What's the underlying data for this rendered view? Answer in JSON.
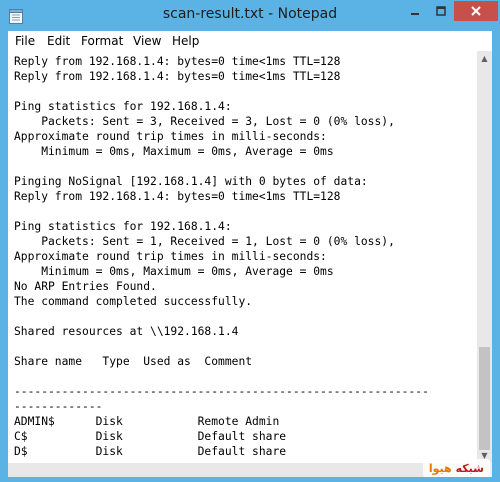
{
  "window": {
    "title": "scan-result.txt - Notepad",
    "accent": "#5ab3e4",
    "close_color": "#c7504b"
  },
  "menu": [
    "File",
    "Edit",
    "Format",
    "View",
    "Help"
  ],
  "text_lines": [
    "Reply from 192.168.1.4: bytes=0 time<1ms TTL=128",
    "Reply from 192.168.1.4: bytes=0 time<1ms TTL=128",
    "",
    "Ping statistics for 192.168.1.4:",
    "    Packets: Sent = 3, Received = 3, Lost = 0 (0% loss),",
    "Approximate round trip times in milli-seconds:",
    "    Minimum = 0ms, Maximum = 0ms, Average = 0ms",
    "",
    "Pinging NoSignal [192.168.1.4] with 0 bytes of data:",
    "Reply from 192.168.1.4: bytes=0 time<1ms TTL=128",
    "",
    "Ping statistics for 192.168.1.4:",
    "    Packets: Sent = 1, Received = 1, Lost = 0 (0% loss),",
    "Approximate round trip times in milli-seconds:",
    "    Minimum = 0ms, Maximum = 0ms, Average = 0ms",
    "No ARP Entries Found.",
    "The command completed successfully.",
    "",
    "Shared resources at \\\\192.168.1.4",
    "",
    "Share name   Type  Used as  Comment",
    "",
    "-------------------------------------------------------------",
    "-------------",
    "ADMIN$      Disk           Remote Admin",
    "C$          Disk           Default share",
    "D$          Disk           Default share"
  ],
  "watermark": {
    "part1": "هیوا",
    "part2": "شبکه"
  }
}
